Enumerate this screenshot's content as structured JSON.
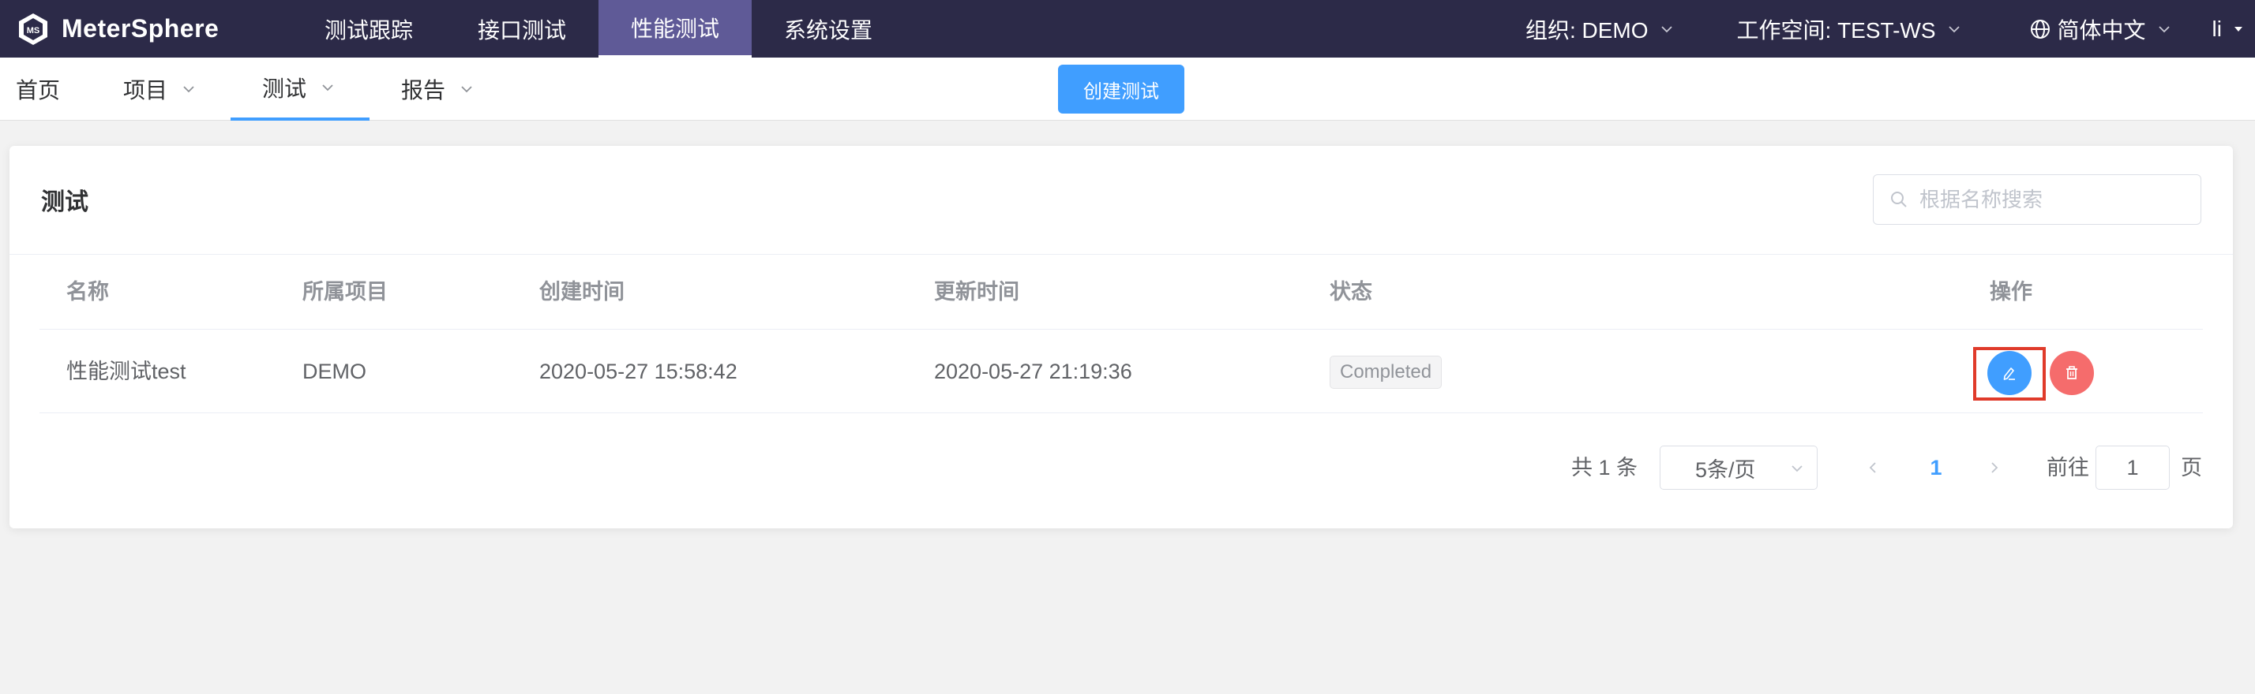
{
  "app": {
    "name": "MeterSphere"
  },
  "top_nav": {
    "items": [
      {
        "label": "测试跟踪",
        "active": false
      },
      {
        "label": "接口测试",
        "active": false
      },
      {
        "label": "性能测试",
        "active": true
      },
      {
        "label": "系统设置",
        "active": false
      }
    ],
    "org_label": "组织: DEMO",
    "workspace_label": "工作空间: TEST-WS",
    "language_label": "简体中文",
    "user_label": "li"
  },
  "sub_nav": {
    "items": [
      {
        "label": "首页",
        "has_dropdown": false,
        "active": false
      },
      {
        "label": "项目",
        "has_dropdown": true,
        "active": false
      },
      {
        "label": "测试",
        "has_dropdown": true,
        "active": true
      },
      {
        "label": "报告",
        "has_dropdown": true,
        "active": false
      }
    ],
    "create_button_label": "创建测试"
  },
  "card": {
    "title": "测试",
    "search_placeholder": "根据名称搜索"
  },
  "table": {
    "columns": [
      "名称",
      "所属项目",
      "创建时间",
      "更新时间",
      "状态",
      "操作"
    ],
    "rows": [
      {
        "name": "性能测试test",
        "project": "DEMO",
        "created_at": "2020-05-27 15:58:42",
        "updated_at": "2020-05-27 21:19:36",
        "status": "Completed"
      }
    ]
  },
  "pagination": {
    "total_text": "共 1 条",
    "page_size_label": "5条/页",
    "current_page": "1",
    "goto_prefix": "前往",
    "goto_value": "1",
    "goto_suffix": "页"
  },
  "colors": {
    "topbar_bg": "#2c2a48",
    "topbar_active_bg": "#5f5a97",
    "primary": "#409eff",
    "danger": "#f56c6c",
    "highlight_box": "#e03b2b"
  }
}
